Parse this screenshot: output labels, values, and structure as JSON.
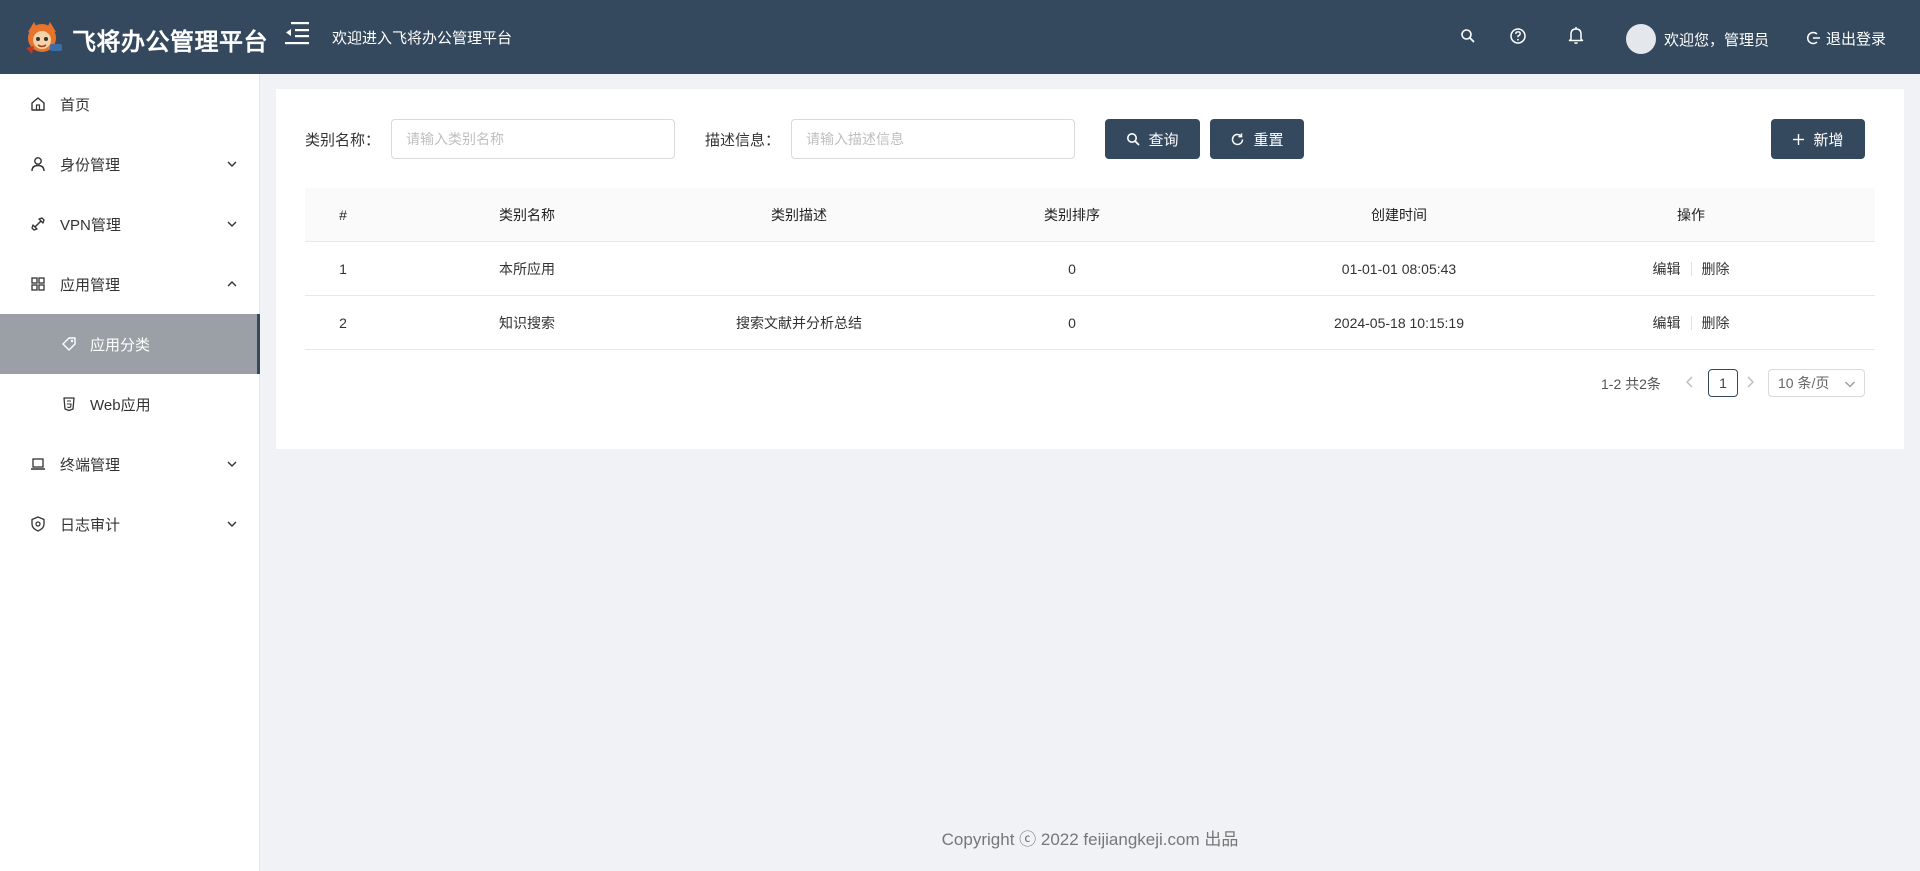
{
  "header": {
    "app_title": "飞将办公管理平台",
    "welcome": "欢迎进入飞将办公管理平台",
    "user_greeting": "欢迎您，管理员",
    "logout": "退出登录",
    "bg_color": "#34495e"
  },
  "sidebar": {
    "items": [
      {
        "label": "首页",
        "icon": "home-icon"
      },
      {
        "label": "身份管理",
        "icon": "user-icon"
      },
      {
        "label": "VPN管理",
        "icon": "vpn-icon"
      },
      {
        "label": "应用管理",
        "icon": "grid-icon"
      },
      {
        "label": "应用分类",
        "icon": "tag-icon"
      },
      {
        "label": "Web应用",
        "icon": "html5-icon"
      },
      {
        "label": "终端管理",
        "icon": "laptop-icon"
      },
      {
        "label": "日志审计",
        "icon": "shield-icon"
      }
    ]
  },
  "search": {
    "name_label": "类别名称：",
    "name_placeholder": "请输入类别名称",
    "desc_label": "描述信息：",
    "desc_placeholder": "请输入描述信息",
    "query_button": "查询",
    "reset_button": "重置",
    "add_button": "新增"
  },
  "table": {
    "headers": [
      "#",
      "类别名称",
      "类别描述",
      "类别排序",
      "创建时间",
      "操作"
    ],
    "rows": [
      {
        "idx": "1",
        "name": "本所应用",
        "desc": "",
        "sort": "0",
        "created": "01-01-01 08:05:43"
      },
      {
        "idx": "2",
        "name": "知识搜索",
        "desc": "搜索文献并分析总结",
        "sort": "0",
        "created": "2024-05-18 10:15:19"
      }
    ],
    "edit": "编辑",
    "delete": "删除"
  },
  "pagination": {
    "total": "1-2 共2条",
    "current_page": "1",
    "page_size": "10 条/页"
  },
  "footer": {
    "copyright": "Copyright ⓒ 2022 feijiangkeji.com 出品"
  }
}
